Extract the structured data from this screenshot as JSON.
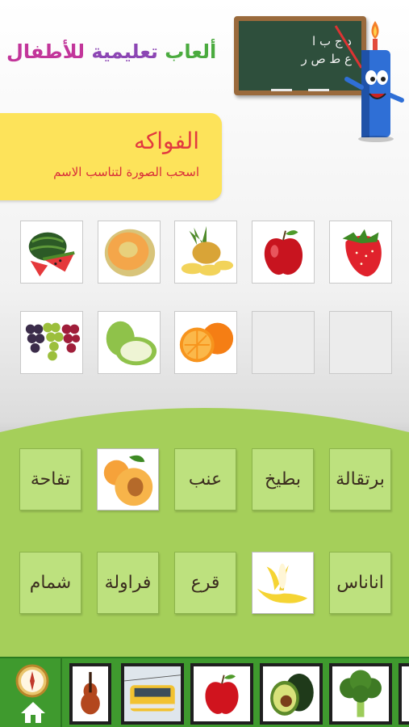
{
  "header": {
    "title_part1": "ألعاب",
    "title_part2": "تعليمية",
    "title_part3": "للأطفال",
    "chalkboard_line1": "د ج ب ا",
    "chalkboard_line2": "ع ط ص ر"
  },
  "category": {
    "title": "الفواكه",
    "subtitle": "اسحب الصورة لتناسب الاسم"
  },
  "picture_slots": [
    {
      "fruit": "watermelon"
    },
    {
      "fruit": "melon"
    },
    {
      "fruit": "pineapple"
    },
    {
      "fruit": "apple"
    },
    {
      "fruit": "strawberry"
    },
    {
      "fruit": "grapes"
    },
    {
      "fruit": "guava"
    },
    {
      "fruit": "orange"
    },
    {
      "fruit": "empty"
    },
    {
      "fruit": "empty"
    }
  ],
  "word_tiles": {
    "row1": [
      "تفاحة",
      "apricot-image",
      "عنب",
      "بطيخ",
      "برتقالة"
    ],
    "row2": [
      "شمام",
      "فراولة",
      "قرع",
      "banana-image",
      "اناناس"
    ]
  },
  "bottom_bar": {
    "items": [
      "compass-home-icon",
      "violin",
      "train",
      "apple",
      "avocado",
      "broccoli"
    ]
  },
  "colors": {
    "accent_green": "#3f9a2e",
    "tile_green": "#bde17e",
    "yellow_card": "#fde35a",
    "title_red": "#e23a3f"
  }
}
